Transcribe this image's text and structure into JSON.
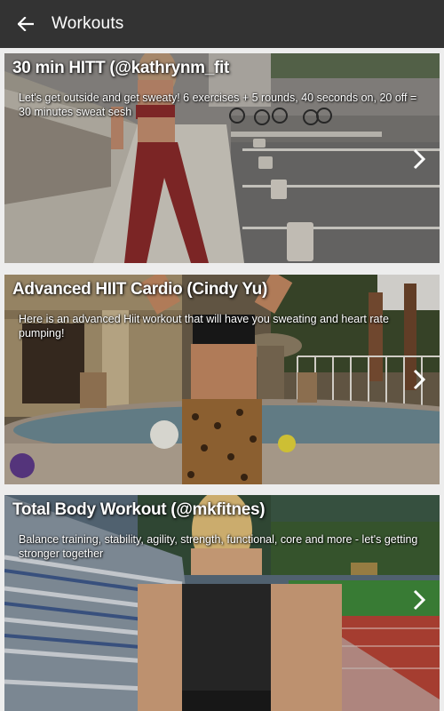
{
  "appbar": {
    "title": "Workouts",
    "back_icon": "arrow-left-icon"
  },
  "colors": {
    "appbar": "#333333",
    "background": "#ededed",
    "text": "#ffffff"
  },
  "workouts": [
    {
      "title": "30 min HITT (@kathrynm_fit",
      "description": "Let's get outside and get sweaty! 6 exercises + 5 rounds, 40 seconds on, 20 off = 30 minutes sweat sesh",
      "chevron_icon": "chevron-right-icon"
    },
    {
      "title": "Advanced HIIT Cardio (Cindy Yu)",
      "description": "Here is an advanced Hiit workout that will have you sweating and heart rate pumping!",
      "chevron_icon": "chevron-right-icon"
    },
    {
      "title": "Total Body Workout (@mkfitnes)",
      "description": "Balance training, stability, agility, strength, functional, core and more - let's getting stronger together",
      "chevron_icon": "chevron-right-icon"
    }
  ]
}
